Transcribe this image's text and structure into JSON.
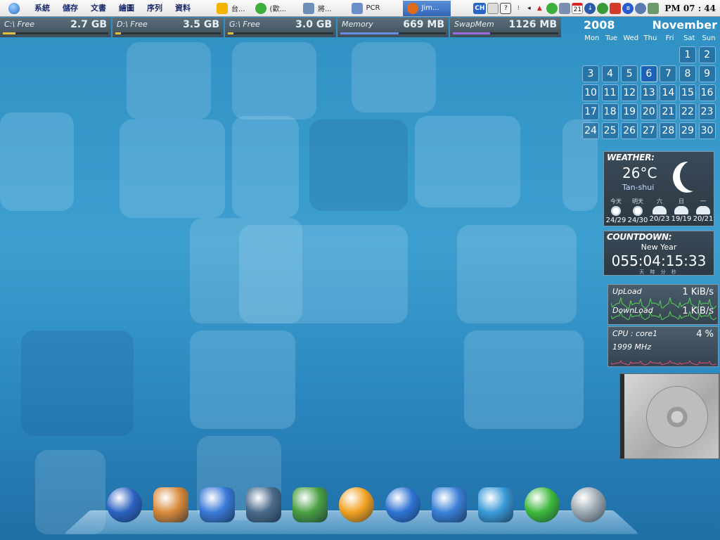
{
  "menubar": {
    "menus": [
      "系統",
      "儲存",
      "文書",
      "繪圖",
      "序列",
      "資料"
    ],
    "tasks": [
      {
        "label": "台...",
        "icon": "app-window-icon",
        "color": "#f2b400"
      },
      {
        "label": "(歡...",
        "icon": "messenger-icon",
        "color": "#3cae3c"
      },
      {
        "label": "將...",
        "icon": "notepad-icon",
        "color": "#6d8fb8"
      },
      {
        "label": "PCR",
        "icon": "folder-icon",
        "color": "#6b8fc9"
      },
      {
        "label": "Jim...",
        "icon": "firefox-icon",
        "color": "#e06a1b",
        "active": true
      }
    ],
    "input_method": "CH",
    "calendar_day": "21",
    "clock": "PM 07 : 44"
  },
  "disks": [
    {
      "label": "C:\\ Free",
      "value": "2.7 GB",
      "fill": 0.12,
      "color": "#e0c040"
    },
    {
      "label": "D:\\ Free",
      "value": "3.5 GB",
      "fill": 0.05,
      "color": "#e0c040"
    },
    {
      "label": "G:\\ Free",
      "value": "3.0 GB",
      "fill": 0.05,
      "color": "#e0c040"
    },
    {
      "label": "Memory",
      "value": "669 MB",
      "fill": 0.55,
      "color": "#6a8ce0"
    },
    {
      "label": "SwapMem",
      "value": "1126 MB",
      "fill": 0.35,
      "color": "#9a6ae0"
    }
  ],
  "calendar": {
    "year": "2008",
    "month": "November",
    "weekdays": [
      "Mon",
      "Tue",
      "Wed",
      "Thu",
      "Fri",
      "Sat",
      "Sun"
    ],
    "leading_blanks": 5,
    "days": [
      "1",
      "2",
      "3",
      "4",
      "5",
      "6",
      "7",
      "8",
      "9",
      "10",
      "11",
      "12",
      "13",
      "14",
      "15",
      "16",
      "17",
      "18",
      "19",
      "20",
      "21",
      "22",
      "23",
      "24",
      "25",
      "26",
      "27",
      "28",
      "29",
      "30"
    ],
    "today": "6"
  },
  "weather": {
    "title": "WEATHER:",
    "temp": "26°C",
    "city": "Tan-shui",
    "forecast": [
      {
        "day": "今天",
        "range": "24/29",
        "icon": "sunny"
      },
      {
        "day": "明天",
        "range": "24/30",
        "icon": "sunny"
      },
      {
        "day": "六",
        "range": "20/23",
        "icon": "cloudy"
      },
      {
        "day": "日",
        "range": "19/19",
        "icon": "cloudy"
      },
      {
        "day": "一",
        "range": "20/21",
        "icon": "cloudy"
      }
    ]
  },
  "countdown": {
    "title": "COUNTDOWN:",
    "event": "New Year",
    "time": "055:04:15:33",
    "units": "天 時 分 秒"
  },
  "network": {
    "upload_label": "UpLoad",
    "upload_value": "1 KiB/s",
    "download_label": "DownLoad",
    "download_value": "1 KiB/s"
  },
  "cpu": {
    "label": "CPU : core1",
    "percent": "4 %",
    "freq": "1999 MHz"
  },
  "dock": [
    {
      "name": "dashboard-icon",
      "color": "#2b62c0"
    },
    {
      "name": "applications-icon",
      "color": "#d98a3a"
    },
    {
      "name": "itunes-icon",
      "color": "#3a7ad8"
    },
    {
      "name": "movie-icon",
      "color": "#4a6a8a"
    },
    {
      "name": "photos-icon",
      "color": "#4aa043"
    },
    {
      "name": "media-player-icon",
      "color": "#f0a020"
    },
    {
      "name": "internet-explorer-icon",
      "color": "#2d73d2"
    },
    {
      "name": "safari-icon",
      "color": "#3a80d8"
    },
    {
      "name": "msn-messenger-icon",
      "color": "#3a9ad8"
    },
    {
      "name": "downloads-icon",
      "color": "#3cb83c"
    },
    {
      "name": "trash-icon",
      "color": "#9aa7b0"
    }
  ]
}
